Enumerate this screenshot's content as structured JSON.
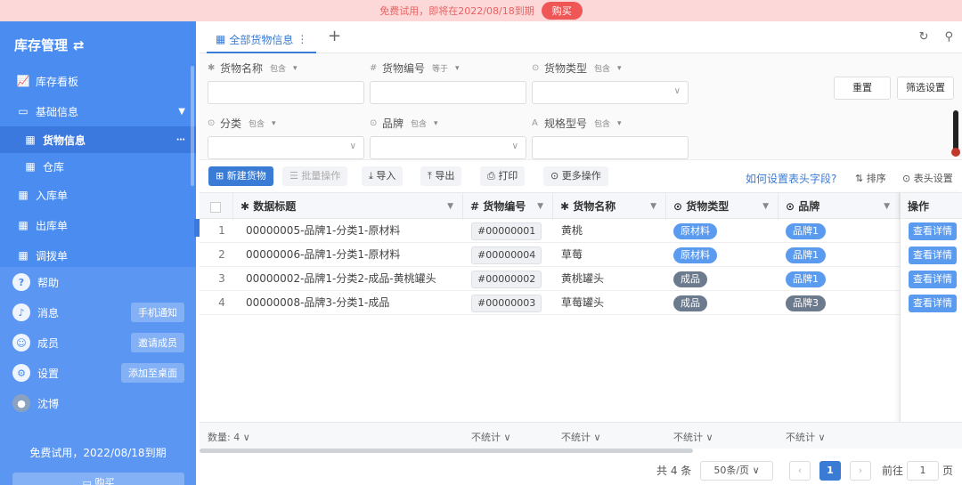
{
  "banner": {
    "text": "免费试用，即将在2022/08/18到期",
    "buy": "购买"
  },
  "sidebar": {
    "brand": "库存管理",
    "nav": [
      {
        "label": "库存看板",
        "icon": "chart-line-icon"
      },
      {
        "label": "基础信息",
        "icon": "window-icon"
      },
      {
        "label": "货物信息",
        "icon": "grid-icon"
      },
      {
        "label": "仓库",
        "icon": "grid-icon"
      },
      {
        "label": "入库单",
        "icon": "grid-icon"
      },
      {
        "label": "出库单",
        "icon": "grid-icon"
      },
      {
        "label": "调拨单",
        "icon": "grid-icon"
      }
    ],
    "lower": [
      {
        "label": "帮助",
        "icon": "help-icon",
        "action": ""
      },
      {
        "label": "消息",
        "icon": "bell-icon",
        "action": "手机通知"
      },
      {
        "label": "成员",
        "icon": "user-icon",
        "action": "邀请成员"
      },
      {
        "label": "设置",
        "icon": "gear-icon",
        "action": "添加至桌面"
      },
      {
        "label": "沈博",
        "icon": "avatar-icon",
        "action": ""
      }
    ],
    "trial": "免费试用，2022/08/18到期",
    "buy": "购买"
  },
  "tab": {
    "label": "全部货物信息"
  },
  "filters": [
    {
      "label": "货物名称",
      "mode": "包含"
    },
    {
      "label": "货物编号",
      "mode": "等于"
    },
    {
      "label": "货物类型",
      "mode": "包含"
    },
    {
      "label": "分类",
      "mode": "包含"
    },
    {
      "label": "品牌",
      "mode": "包含"
    },
    {
      "label": "规格型号",
      "mode": "包含"
    }
  ],
  "filter_buttons": {
    "reset": "重置",
    "settings": "筛选设置"
  },
  "toolbar": {
    "new": "新建货物",
    "batch": "批量操作",
    "import": "导入",
    "export": "导出",
    "print": "打印",
    "more": "更多操作",
    "help_link": "如何设置表头字段?",
    "sort": "排序",
    "header_settings": "表头设置"
  },
  "columns": [
    "数据标题",
    "货物编号",
    "货物名称",
    "货物类型",
    "品牌",
    "操作"
  ],
  "rows": [
    {
      "idx": "1",
      "title": "00000005-品牌1-分类1-原材料",
      "code": "#00000001",
      "name": "黄桃",
      "type": "原材料",
      "brand": "品牌1",
      "op": "查看详情"
    },
    {
      "idx": "2",
      "title": "00000006-品牌1-分类1-原材料",
      "code": "#00000004",
      "name": "草莓",
      "type": "原材料",
      "brand": "品牌1",
      "op": "查看详情"
    },
    {
      "idx": "3",
      "title": "00000002-品牌1-分类2-成品-黄桃罐头",
      "code": "#00000002",
      "name": "黄桃罐头",
      "type": "成品",
      "brand": "品牌1",
      "op": "查看详情"
    },
    {
      "idx": "4",
      "title": "00000008-品牌3-分类1-成品",
      "code": "#00000003",
      "name": "草莓罐头",
      "type": "成品",
      "brand": "品牌3",
      "op": "查看详情"
    }
  ],
  "footer": {
    "count": "数量: 4",
    "stat": "不统计"
  },
  "pager": {
    "total": "共 4 条",
    "size": "50条/页",
    "page": "1",
    "goto": "前往",
    "goto_value": "1",
    "suffix": "页"
  },
  "colors": {
    "sidebar": "#4a8cf0",
    "accent": "#3a7bd5",
    "banner": "#fdd8d8"
  }
}
